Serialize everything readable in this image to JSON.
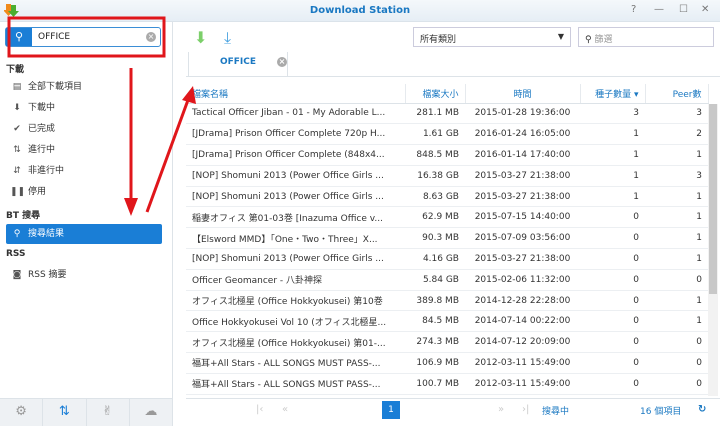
{
  "window": {
    "title": "Download Station",
    "help": "?",
    "minimize": "—",
    "maximize": "☐",
    "close": "✕"
  },
  "sidebar": {
    "search_value": "OFFICE",
    "sections": {
      "download": "下載",
      "bt_search": "BT 搜尋",
      "rss": "RSS"
    },
    "items": [
      {
        "label": "全部下載項目",
        "icon": "document-icon"
      },
      {
        "label": "下載中",
        "icon": "arrow-down-icon"
      },
      {
        "label": "已完成",
        "icon": "check-icon"
      },
      {
        "label": "進行中",
        "icon": "arrows-updown-icon"
      },
      {
        "label": "非進行中",
        "icon": "inactive-icon"
      },
      {
        "label": "停用",
        "icon": "pause-icon"
      },
      {
        "label": "搜尋結果",
        "icon": "search-icon",
        "active": true
      },
      {
        "label": "RSS 摘要",
        "icon": "rss-icon"
      }
    ]
  },
  "toolbar": {
    "category": "所有類別",
    "filter_placeholder": "篩選"
  },
  "tab": {
    "label": "OFFICE"
  },
  "table": {
    "headers": [
      "檔案名稱",
      "檔案大小",
      "時間",
      "種子數量",
      "Peer數"
    ],
    "rows": [
      [
        "Tactical Officer Jiban - 01 - My Adorable L...",
        "281.1 MB",
        "2015-01-28 19:36:00",
        "3",
        "3"
      ],
      [
        "[JDrama] Prison Officer Complete 720p H...",
        "1.61 GB",
        "2016-01-24 16:05:00",
        "1",
        "2"
      ],
      [
        "[JDrama] Prison Officer Complete (848x4...",
        "848.5 MB",
        "2016-01-14 17:40:00",
        "1",
        "1"
      ],
      [
        "[NOP] Shomuni 2013 (Power Office Girls ...",
        "16.38 GB",
        "2015-03-27 21:38:00",
        "1",
        "3"
      ],
      [
        "[NOP] Shomuni 2013 (Power Office Girls ...",
        "8.63 GB",
        "2015-03-27 21:38:00",
        "1",
        "1"
      ],
      [
        "稲妻オフィス 第01-03巻 [Inazuma Office v...",
        "62.9 MB",
        "2015-07-15 14:40:00",
        "0",
        "1"
      ],
      [
        "【Elsword MMD】「One・Two・Three」X...",
        "90.3 MB",
        "2015-07-09 03:56:00",
        "0",
        "1"
      ],
      [
        "[NOP] Shomuni 2013 (Power Office Girls ...",
        "4.16 GB",
        "2015-03-27 21:38:00",
        "0",
        "1"
      ],
      [
        "Officer Geomancer - 八卦神探",
        "5.84 GB",
        "2015-02-06 11:32:00",
        "0",
        "0"
      ],
      [
        "オフィス北極星 (Office Hokkyokusei) 第10巻",
        "389.8 MB",
        "2014-12-28 22:28:00",
        "0",
        "1"
      ],
      [
        "Office Hokkyokusei Vol 10 (オフィス北極星...",
        "84.5 MB",
        "2014-07-14 00:22:00",
        "0",
        "1"
      ],
      [
        "オフィス北極星 (Office Hokkyokusei) 第01-...",
        "274.3 MB",
        "2014-07-12 20:09:00",
        "0",
        "0"
      ],
      [
        "福耳+All Stars - ALL SONGS MUST PASS-...",
        "106.9 MB",
        "2012-03-11 15:49:00",
        "0",
        "0"
      ],
      [
        "福耳+All Stars - ALL SONGS MUST PASS-...",
        "100.7 MB",
        "2012-03-11 15:49:00",
        "0",
        "0"
      ]
    ]
  },
  "footer": {
    "page": "1",
    "status": "搜尋中",
    "count": "16 個項目"
  },
  "colors": {
    "accent": "#1a7ed6",
    "annotation": "#e0161b"
  }
}
